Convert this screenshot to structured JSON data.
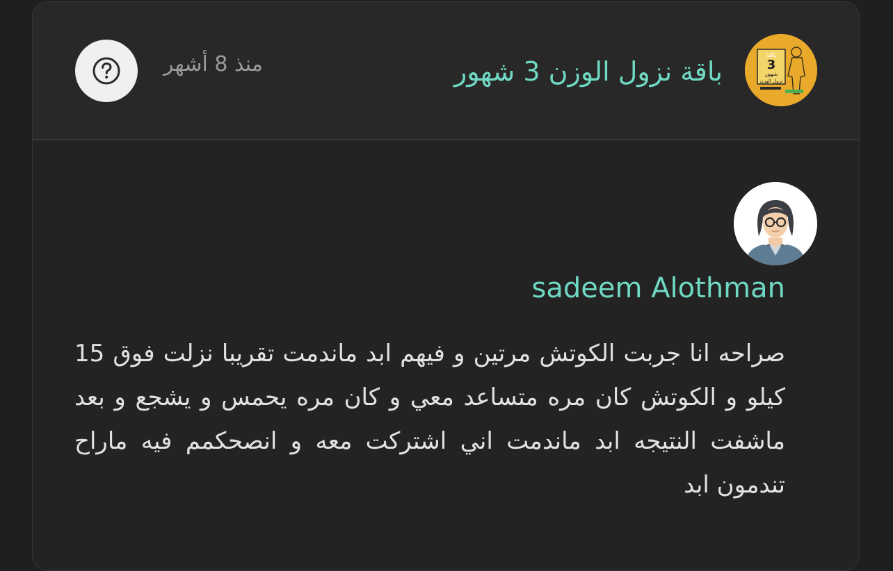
{
  "product": {
    "title": "باقة نزول الوزن 3 شهور",
    "time_ago": "منذ 8 أشهر",
    "thumb_text_top": "باقة",
    "thumb_number": "3",
    "thumb_text_mid": "شهور",
    "thumb_text_bottom": "نزول الوزن"
  },
  "review": {
    "reviewer_name": "sadeem Alothman",
    "text": "صراحه انا جربت الكوتش مرتين و فيهم ابد ماندمت تقريبا نزلت فوق 15 كيلو و الكوتش كان مره متساعد معي و كان مره يحمس و يشجع و بعد ماشفت النتيجه ابد ماندمت اني اشتركت معه و انصحكمم فيه ماراح تندمون ابد"
  },
  "colors": {
    "accent": "#6fd9c4",
    "background": "#1f1f1f",
    "card": "#282828",
    "thumb_bg": "#e9a92b"
  },
  "icons": {
    "help": "question-circle-icon",
    "avatar": "female-avatar-icon"
  }
}
